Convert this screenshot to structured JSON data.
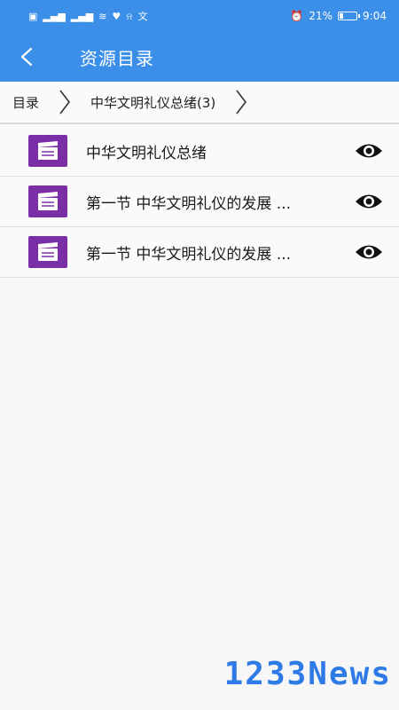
{
  "status_bar": {
    "left_icons": [
      "HD",
      "4G",
      "4G",
      "wifi",
      "heart",
      "bell",
      "text"
    ],
    "battery_percent": "21%",
    "battery_level": 0.21,
    "time": "9:04"
  },
  "app_bar": {
    "title": "资源目录"
  },
  "breadcrumb": {
    "items": [
      "目录",
      "中华文明礼仪总绪(3)"
    ]
  },
  "list": [
    {
      "title": "中华文明礼仪总绪"
    },
    {
      "title": "第一节 中华文明礼仪的发展 ..."
    },
    {
      "title": "第一节 中华文明礼仪的发展 ..."
    }
  ],
  "watermark": "1233News",
  "colors": {
    "primary": "#3b8fe8",
    "file_icon": "#7b2fa6",
    "watermark": "#2e7be8"
  }
}
